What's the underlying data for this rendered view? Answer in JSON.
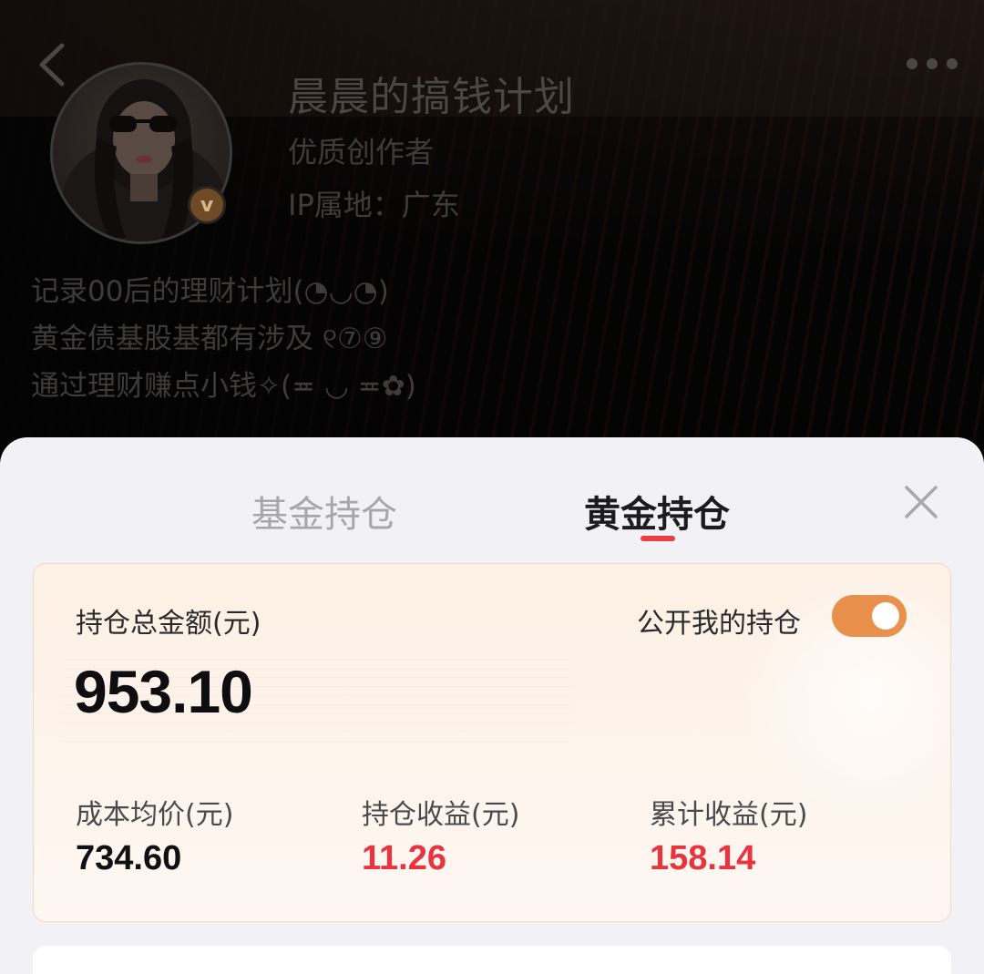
{
  "profile": {
    "name": "晨晨的搞钱计划",
    "role": "优质创作者",
    "ip_location": "IP属地：广东",
    "verified_badge": "v",
    "bio": [
      "记录00后的理财计划(◔◡◔)",
      "黄金债基股基都有涉及 ୧⑦⑨",
      "通过理财赚点小钱✧(≖ ◡ ≖✿)"
    ]
  },
  "icons": {
    "back": "chevron-left-icon",
    "more": "more-dots-icon",
    "close": "close-icon"
  },
  "sheet": {
    "tabs": [
      {
        "label": "基金持仓",
        "active": false
      },
      {
        "label": "黄金持仓",
        "active": true
      }
    ]
  },
  "holdings": {
    "total_label": "持仓总金额(元)",
    "total_value": "953.10",
    "public_label": "公开我的持仓",
    "public_enabled": true,
    "stats": [
      {
        "label": "成本均价(元)",
        "value": "734.60",
        "color": "#111113"
      },
      {
        "label": "持仓收益(元)",
        "value": "11.26",
        "color": "#e8343f"
      },
      {
        "label": "累计收益(元)",
        "value": "158.14",
        "color": "#e8343f"
      }
    ]
  },
  "colors": {
    "accent_red": "#ef3d46",
    "toggle_orange": "#e9904c",
    "profit_red": "#e8343f"
  }
}
